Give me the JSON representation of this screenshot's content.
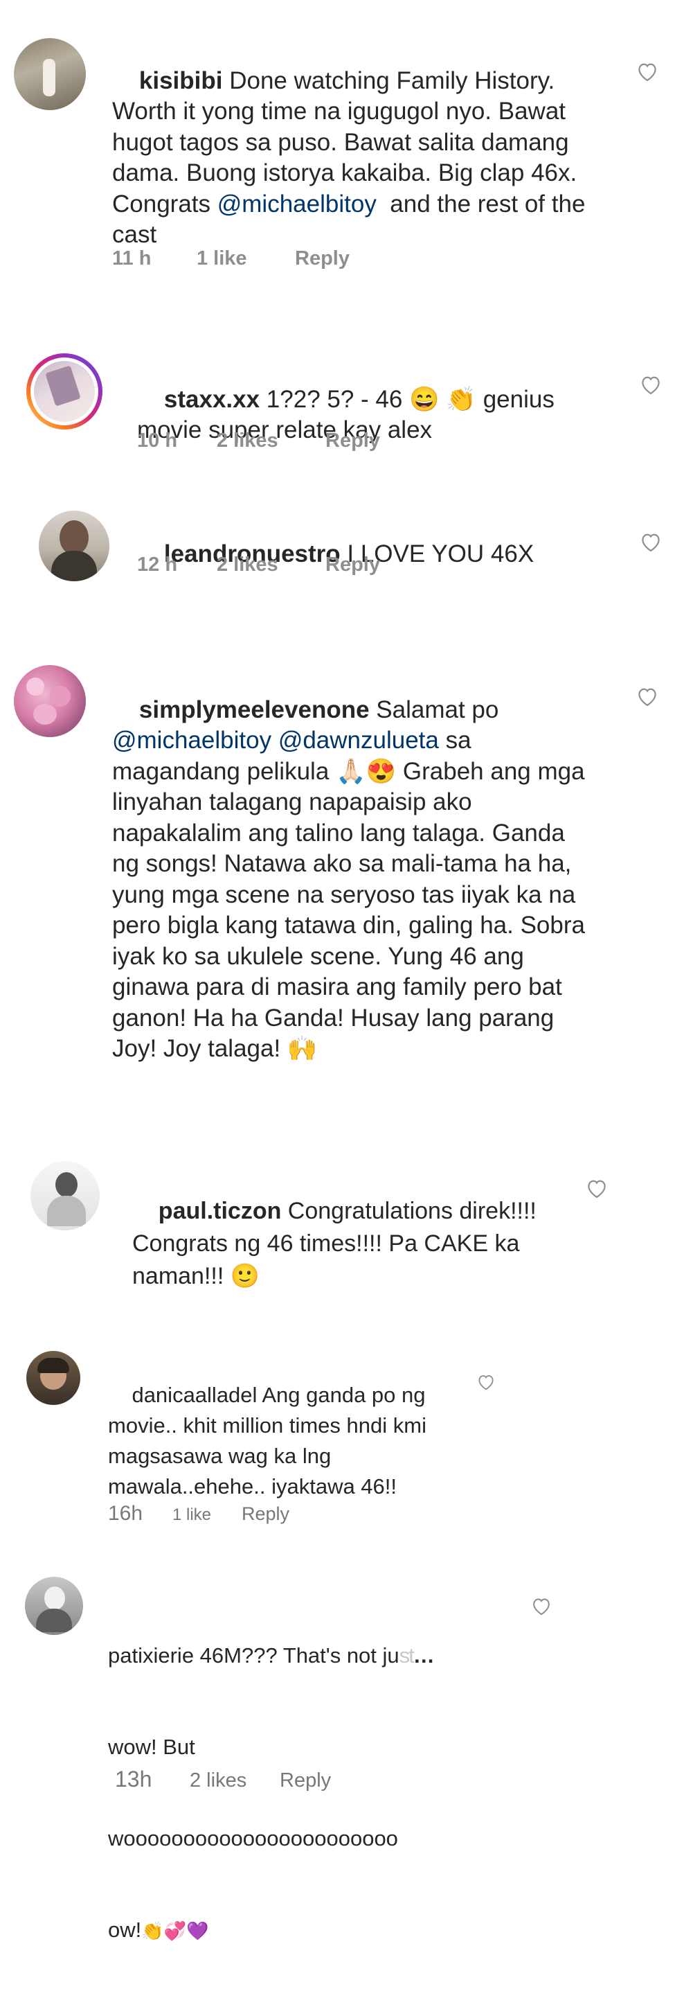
{
  "comments": [
    {
      "username": "kisibibi",
      "text": " Done watching Family History. Worth it yong time na igugugol nyo. Bawat hugot tagos sa puso. Bawat salita damang dama. Buong istorya kakaiba. Big clap 46x. Congrats ",
      "mention1": "@michaelbitoy",
      "text_after": "  and the rest of the cast",
      "time": "11 h",
      "likes": "1 like",
      "reply": "Reply"
    },
    {
      "username": "staxx.xx",
      "text_a": " 1?2? 5? - 46 ",
      "emoji": "😄 👏",
      "text_b": " genius movie super relate kay alex",
      "time": "10 h",
      "likes": "2 likes",
      "reply": "Reply"
    },
    {
      "username": "leandronuestro",
      "text": " I LOVE YOU 46X",
      "time": "12 h",
      "likes": "2 likes",
      "reply": "Reply"
    },
    {
      "username": "simplymeelevenone",
      "text_a": " Salamat po ",
      "mention1": "@michaelbitoy",
      "mention2": "@dawnzulueta",
      "text_b": " sa magandang pelikula ",
      "emoji": "🙏🏻😍",
      "text_c": " Grabeh ang mga linyahan talagang napapaisip ako napakalalim ang talino lang talaga. Ganda ng songs! Natawa ako sa mali-tama ha ha, yung mga scene na seryoso tas iiyak ka na pero bigla kang tatawa din, galing ha. Sobra iyak ko sa ukulele scene. Yung 46 ang ginawa para di masira ang family pero bat ganon! Ha ha Ganda! Husay lang parang Joy! Joy talaga! ",
      "emoji2": "🙌"
    },
    {
      "username": "paul.ticzon",
      "text": " Congratulations direk!!!! Congrats ng 46 times!!!! Pa CAKE ka naman!!! ",
      "emoji": "🙂"
    },
    {
      "username": "danicaalladel",
      "text": " Ang ganda po ng movie.. khit million times hndi kmi magsasawa wag ka lng mawala..ehehe.. iyaktawa 46!!",
      "time": "16h",
      "likes": "1 like",
      "reply": "Reply"
    },
    {
      "username": "patixierie",
      "text_a": " 46M??? That's not ju",
      "text_b": "wow! But",
      "text_c": "wooooooooooooooooooooooo",
      "text_d": "ow!",
      "emoji": "👏💞💜",
      "time": "13h",
      "likes": "2 likes",
      "reply": "Reply"
    }
  ],
  "icons": [
    "heart-outline-icon"
  ],
  "colors": {
    "text": "#262626",
    "meta": "#8e8e8e",
    "mention": "#003569"
  }
}
